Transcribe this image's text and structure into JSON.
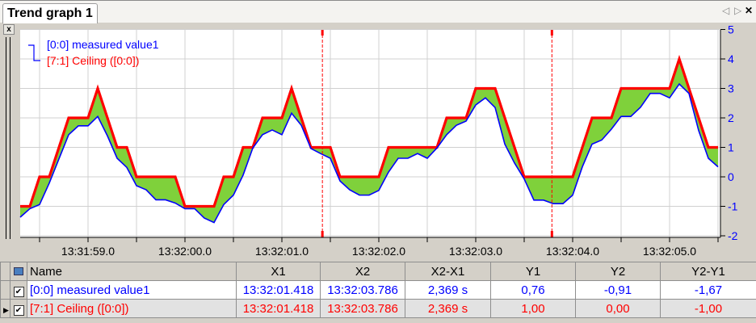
{
  "window": {
    "tab_label": "Trend graph 1",
    "controls": {
      "prev": "◁",
      "next": "▷",
      "close": "✕"
    },
    "panel_close": "x"
  },
  "colors": {
    "series1": "#0000ff",
    "series2": "#ff0000",
    "fill": "#7fd13b",
    "cursor": "#ff0000",
    "grid": "#d0d0d0"
  },
  "legend": [
    {
      "label": "[0:0] measured value1",
      "color": "#0000ff"
    },
    {
      "label": "[7:1] Ceiling ([0:0])",
      "color": "#ff0000"
    }
  ],
  "chart_data": {
    "type": "line",
    "x_unit": "seconds after 13:31:59.0",
    "xlim": [
      -0.7,
      6.52
    ],
    "ylim": [
      -2.1,
      5.0
    ],
    "y_ticks": [
      5,
      4,
      3,
      2,
      1,
      0,
      -1,
      -2
    ],
    "x_tick_labels": [
      "13:31:59.0",
      "13:32:00.0",
      "13:32:01.0",
      "13:32:02.0",
      "13:32:03.0",
      "13:32:04.0",
      "13:32:05.0"
    ],
    "x_tick_values": [
      0,
      1,
      2,
      3,
      4,
      5,
      6
    ],
    "grid": true,
    "x_start": -0.7,
    "x_step": 0.1,
    "series": [
      {
        "name": "[0:0] measured value1",
        "values": [
          -1.37,
          -1.08,
          -0.94,
          -0.21,
          0.61,
          1.43,
          1.73,
          1.73,
          2.05,
          1.39,
          0.63,
          0.32,
          -0.3,
          -0.44,
          -0.78,
          -0.78,
          -0.89,
          -1.08,
          -1.08,
          -1.4,
          -1.55,
          -0.94,
          -0.62,
          0.06,
          0.98,
          1.43,
          1.59,
          1.43,
          2.16,
          1.75,
          0.96,
          0.79,
          0.63,
          -0.14,
          -0.44,
          -0.62,
          -0.62,
          -0.46,
          0.16,
          0.63,
          0.63,
          0.79,
          0.63,
          0.98,
          1.43,
          1.75,
          1.89,
          2.44,
          2.68,
          2.35,
          1.11,
          0.47,
          -0.07,
          -0.79,
          -0.79,
          -0.91,
          -0.91,
          -0.62,
          0.34,
          1.11,
          1.25,
          1.62,
          2.05,
          2.05,
          2.36,
          2.83,
          2.83,
          2.68,
          3.15,
          2.83,
          1.57,
          0.63,
          0.34
        ]
      },
      {
        "name": "[7:1] Ceiling ([0:0])",
        "derived": "ceiling of series 1"
      }
    ],
    "cursors": [
      2.418,
      4.786
    ]
  },
  "table": {
    "headers": [
      "Name",
      "X1",
      "X2",
      "X2-X1",
      "Y1",
      "Y2",
      "Y2-Y1"
    ],
    "rows": [
      {
        "checked": true,
        "cells": [
          "[0:0] measured value1",
          "13:32:01.418",
          "13:32:03.786",
          "2,369 s",
          "0,76",
          "-0,91",
          "-1,67"
        ]
      },
      {
        "checked": true,
        "current": true,
        "cells": [
          "[7:1] Ceiling ([0:0])",
          "13:32:01.418",
          "13:32:03.786",
          "2,369 s",
          "1,00",
          "0,00",
          "-1,00"
        ]
      }
    ]
  }
}
